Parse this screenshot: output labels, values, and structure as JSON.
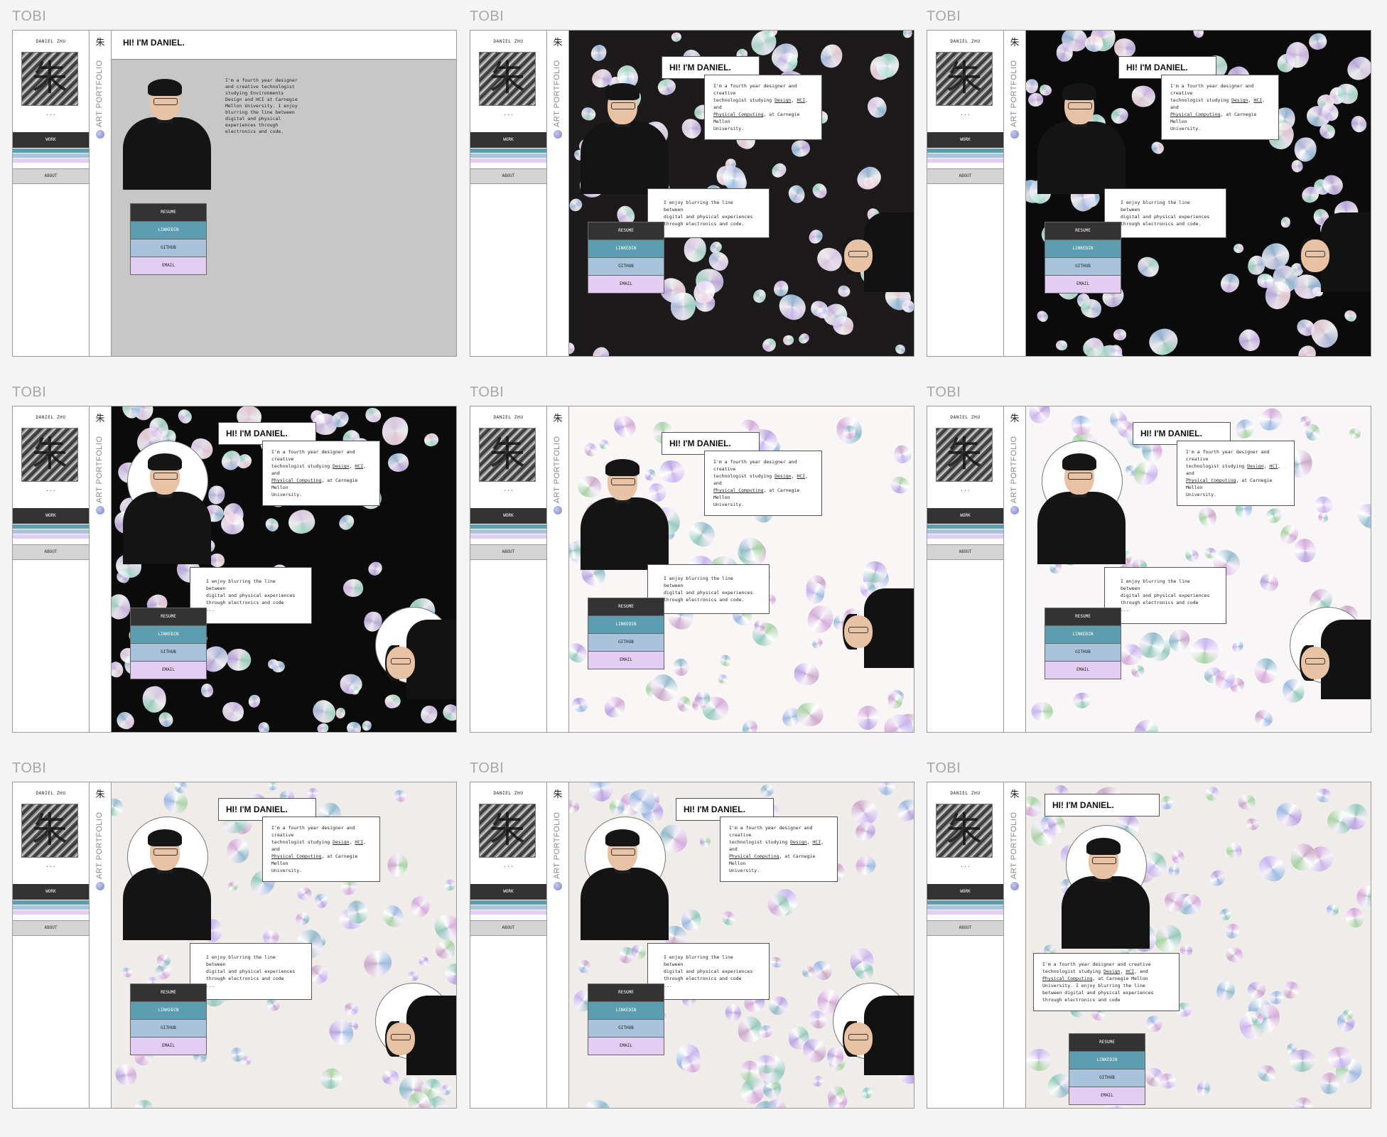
{
  "app_label": "TOBI",
  "profile": {
    "name": "DANIEL ZHU",
    "kanji": "朱",
    "ellipsis": "...",
    "vertical_label": "ART PORTFOLIO"
  },
  "nav": {
    "work": "WORK",
    "about": "ABOUT"
  },
  "colors": {
    "stripe_teal": "#5c9eaf",
    "stripe_blue": "#aac3dc",
    "stripe_lavender": "#e4cdf3"
  },
  "hero": {
    "title": "HI! I'M DANIEL.",
    "intro_line_1": "I'm a fourth year designer and creative",
    "intro_line_2_pre": "technologist studying ",
    "design": "Design",
    "sep": ", ",
    "hci": "HCI",
    "and": ", and",
    "physical": "Physical Computing",
    "cmu": ", at Carnegie Mellon",
    "university": "University.",
    "blurb_1": "I enjoy blurring the line between",
    "blurb_2": "digital and physical experiences",
    "blurb_3": "through electronics and code.",
    "blurb_3_nodot": "through electronics and code",
    "blurb_more": "...",
    "v1_lines": [
      "I'm a fourth year designer",
      "and creative technologist",
      "studying Environments",
      "Design and HCI at Carnegie",
      "Mellon University. I enjoy",
      "blurring the line between",
      "digital and physical",
      "experiences through",
      "electronics and code."
    ],
    "last_1": "I'm a fourth year designer and creative",
    "last_2_pre": "technologist studying ",
    "last_3_post": ", at Carnegie Mellon",
    "last_4": "University. I enjoy blurring the line",
    "last_5": "between digital and physical experiences",
    "last_6": "through electronics and code"
  },
  "links": {
    "resume": "RESUME",
    "linkedin": "LINKEDIN",
    "github": "GITHUB",
    "email": "EMAIL"
  }
}
